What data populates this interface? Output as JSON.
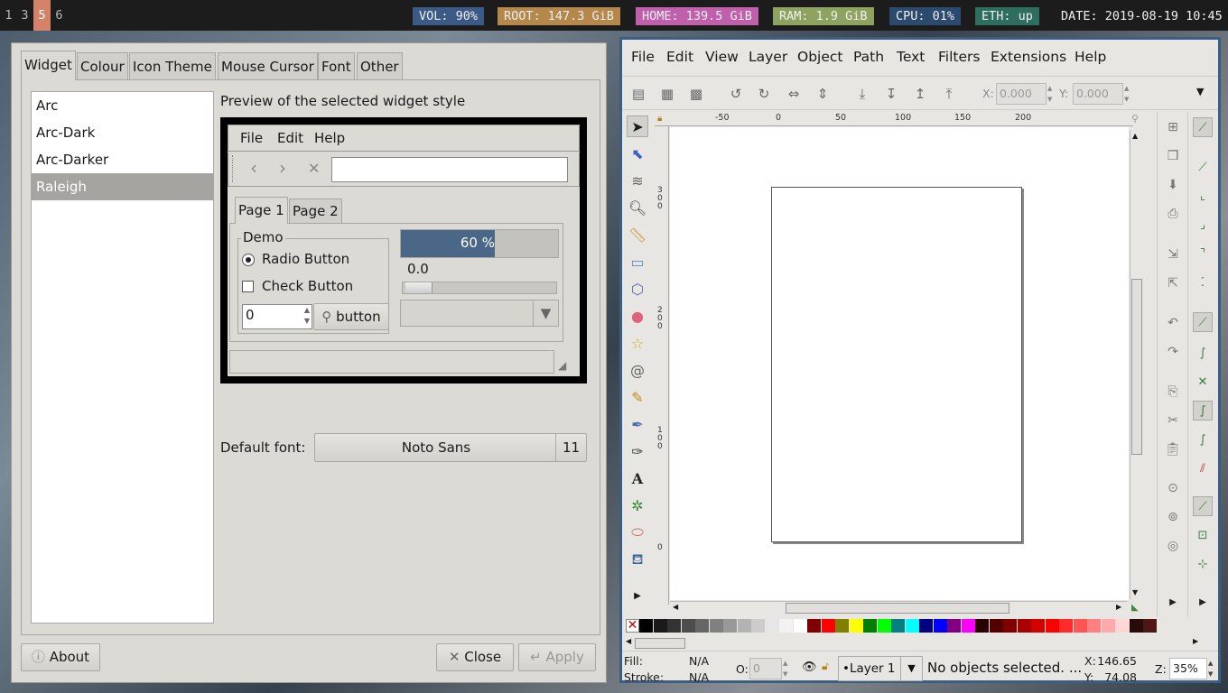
{
  "topbar": {
    "workspaces": [
      "1",
      "3",
      "5",
      "6"
    ],
    "active_workspace": "5",
    "status": [
      {
        "text": "VOL: 90%",
        "color": "#3b5a86"
      },
      {
        "text": "ROOT: 147.3 GiB",
        "color": "#b5874a"
      },
      {
        "text": "HOME: 139.5 GiB",
        "color": "#c060ad"
      },
      {
        "text": "RAM: 1.9 GiB",
        "color": "#8ea35f"
      },
      {
        "text": "CPU: 01%",
        "color": "#2c4a6e"
      },
      {
        "text": "ETH: up",
        "color": "#2e6e5f"
      },
      {
        "text": "DATE: 2019-08-19 10:45",
        "color": "#1c1c1c"
      }
    ]
  },
  "lxappearance": {
    "tabs": [
      "Widget",
      "Colour",
      "Icon Theme",
      "Mouse Cursor",
      "Font",
      "Other"
    ],
    "active_tab": "Widget",
    "themes": [
      "Arc",
      "Arc-Dark",
      "Arc-Darker",
      "Raleigh"
    ],
    "selected_theme": "Raleigh",
    "preview_label": "Preview of the selected widget style",
    "preview": {
      "menu": [
        "File",
        "Edit",
        "Help"
      ],
      "tabs": [
        "Page 1",
        "Page 2"
      ],
      "demo_label": "Demo",
      "radio_label": "Radio Button",
      "check_label": "Check Button",
      "spin_value": "0",
      "button_label": "button",
      "progress_text": "60 %",
      "progress_value": 0.6,
      "scale_value": "0.0"
    },
    "default_font_label": "Default font:",
    "font_name": "Noto Sans",
    "font_size": "11",
    "about_label": "About",
    "close_label": "Close",
    "apply_label": "Apply"
  },
  "inkscape": {
    "menu": [
      "File",
      "Edit",
      "View",
      "Layer",
      "Object",
      "Path",
      "Text",
      "Filters",
      "Extensions",
      "Help"
    ],
    "x_label": "X:",
    "x_value": "0.000",
    "y_label": "Y:",
    "y_value": "0.000",
    "ruler_h": [
      "-50",
      "0",
      "50",
      "100",
      "150",
      "200"
    ],
    "ruler_v": [
      "300",
      "200",
      "100",
      "0"
    ],
    "fill_label": "Fill:",
    "fill_value": "N/A",
    "stroke_label": "Stroke:",
    "stroke_value": "N/A",
    "opacity_label": "O:",
    "opacity_value": "0",
    "layer_name": "Layer 1",
    "status_message": "No objects selected. ...",
    "cursor_x_label": "X:",
    "cursor_x": "146.65",
    "cursor_y_label": "Y:",
    "cursor_y": "74.08",
    "zoom_label": "Z:",
    "zoom_value": "35%",
    "palette": [
      "#000000",
      "#1a1a1a",
      "#333333",
      "#4d4d4d",
      "#666666",
      "#808080",
      "#999999",
      "#b3b3b3",
      "#cccccc",
      "#e6e6e6",
      "#f2f2f2",
      "#ffffff",
      "#800000",
      "#ff0000",
      "#808000",
      "#ffff00",
      "#008000",
      "#00ff00",
      "#008080",
      "#00ffff",
      "#000080",
      "#0000ff",
      "#800080",
      "#ff00ff",
      "#2b0000",
      "#550000",
      "#800000",
      "#aa0000",
      "#d40000",
      "#ff0000",
      "#ff2a2a",
      "#ff5555",
      "#ff8080",
      "#ffaaaa",
      "#ffd5d5",
      "#280b0b",
      "#501616"
    ]
  }
}
